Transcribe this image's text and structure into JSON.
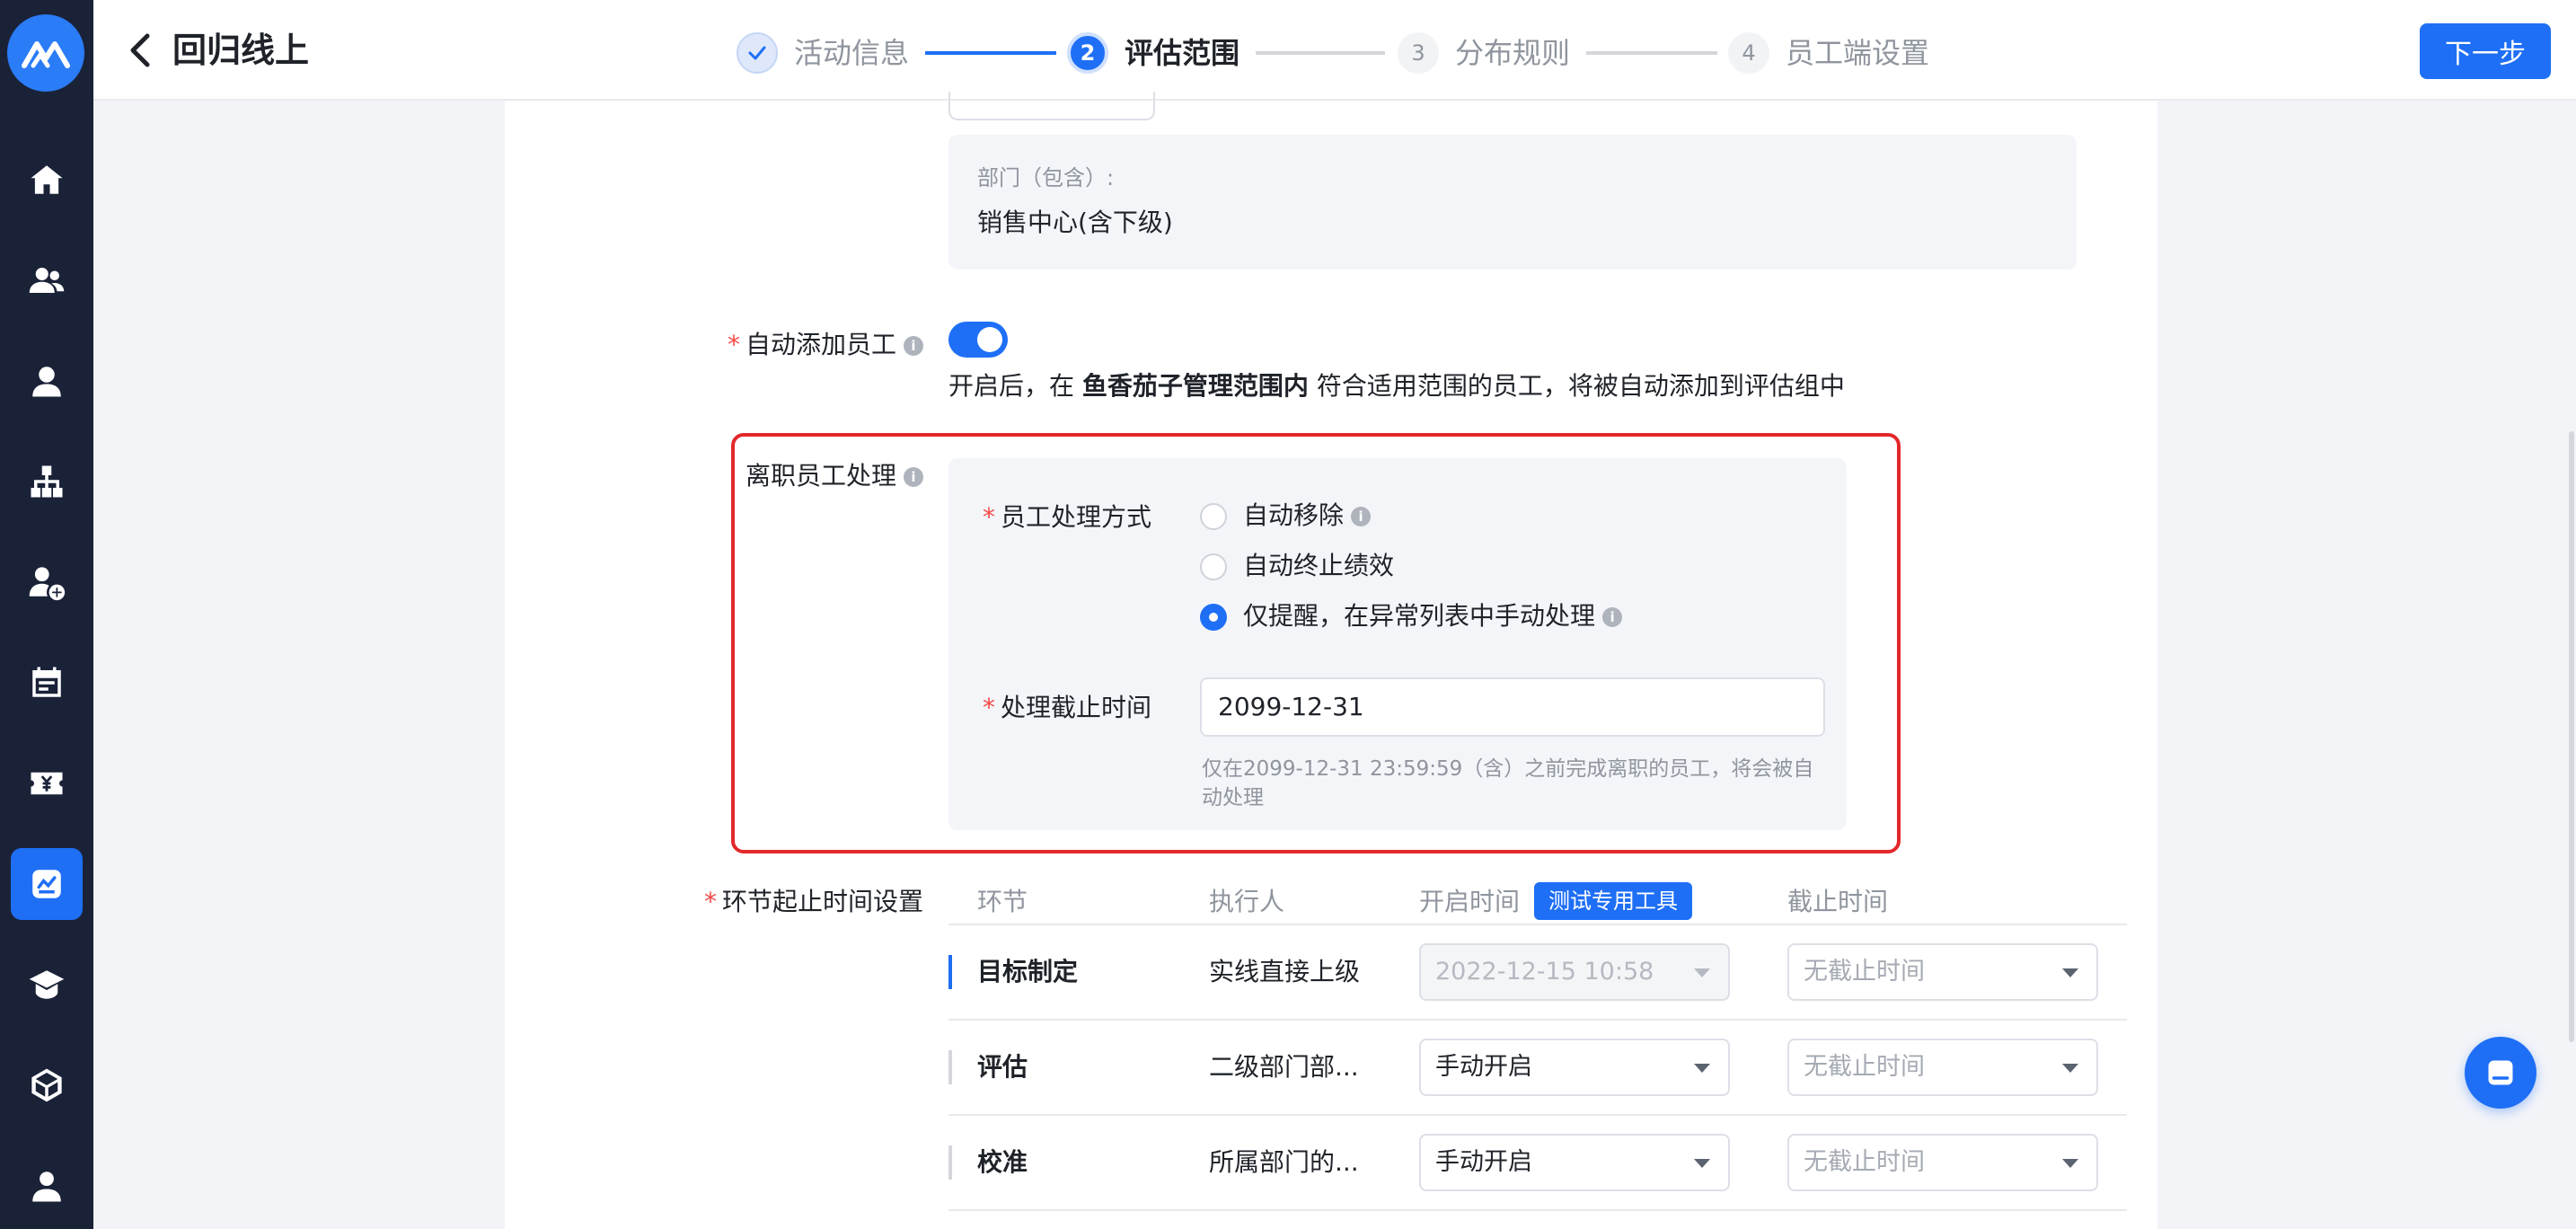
{
  "header": {
    "title": "回归线上",
    "next_label": "下一步"
  },
  "steps": [
    {
      "num": "",
      "label": "活动信息",
      "state": "done"
    },
    {
      "num": "2",
      "label": "评估范围",
      "state": "current"
    },
    {
      "num": "3",
      "label": "分布规则",
      "state": "todo"
    },
    {
      "num": "4",
      "label": "员工端设置",
      "state": "todo"
    }
  ],
  "scope": {
    "dept_label": "部门（包含）:",
    "dept_value": "销售中心(含下级)"
  },
  "auto_add": {
    "label": "自动添加员工",
    "enabled": true,
    "desc_prefix": "开启后，在 ",
    "desc_bold": "鱼香茄子管理范围内",
    "desc_suffix": " 符合适用范围的员工，将被自动添加到评估组中"
  },
  "leave": {
    "label": "离职员工处理",
    "method_label": "员工处理方式",
    "options": [
      {
        "label": "自动移除",
        "checked": false
      },
      {
        "label": "自动终止绩效",
        "checked": false
      },
      {
        "label": "仅提醒，在异常列表中手动处理",
        "checked": true
      }
    ],
    "deadline_label": "处理截止时间",
    "deadline_value": "2099-12-31",
    "deadline_hint": "仅在2099-12-31 23:59:59（含）之前完成离职的员工，将会被自动处理"
  },
  "stages": {
    "label": "环节起止时间设置",
    "headers": {
      "stage": "环节",
      "executor": "执行人",
      "start": "开启时间",
      "end": "截止时间"
    },
    "test_tag": "测试专用工具",
    "rows": [
      {
        "name": "目标制定",
        "executor": "实线直接上级",
        "start": "2022-12-15 10:58",
        "end": "无截止时间",
        "active": true
      },
      {
        "name": "评估",
        "executor": "二级部门部...",
        "start": "手动开启",
        "end": "无截止时间",
        "active": false
      },
      {
        "name": "校准",
        "executor": "所属部门的...",
        "start": "手动开启",
        "end": "无截止时间",
        "active": false
      }
    ]
  },
  "colors": {
    "accent": "#1e6ff6",
    "sidebar": "#1a2238",
    "highlight": "#e3282a"
  }
}
